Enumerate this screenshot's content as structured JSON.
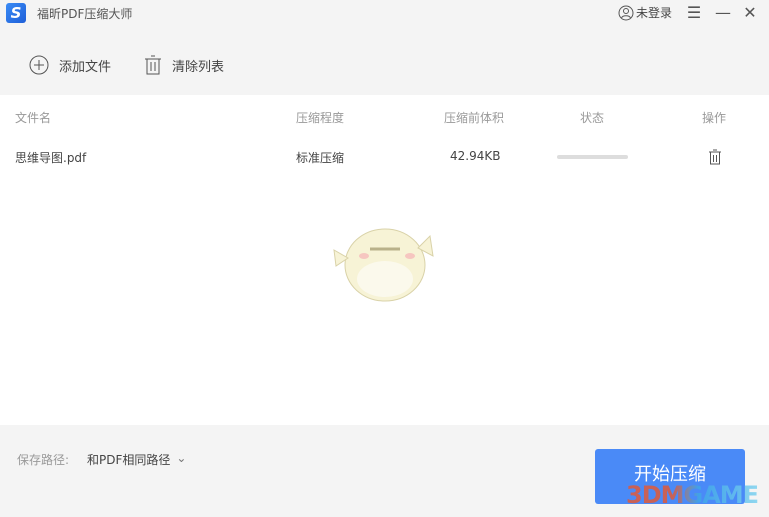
{
  "app": {
    "title": "福昕PDF压缩大师",
    "logo_letter": "S",
    "login_label": "未登录"
  },
  "toolbar": {
    "add_label": "添加文件",
    "clear_label": "清除列表"
  },
  "table": {
    "headers": [
      "文件名",
      "压缩程度",
      "压缩前体积",
      "状态",
      "操作"
    ],
    "rows": [
      {
        "name": "思维导图.pdf",
        "level": "标准压缩",
        "size": "42.94KB",
        "progress": 0
      }
    ]
  },
  "footer": {
    "path_label": "保存路径:",
    "path_value": "和PDF相同路径",
    "start_label": "开始压缩"
  },
  "watermark": "3DMGAME",
  "colors": {
    "accent": "#4a8af7"
  }
}
